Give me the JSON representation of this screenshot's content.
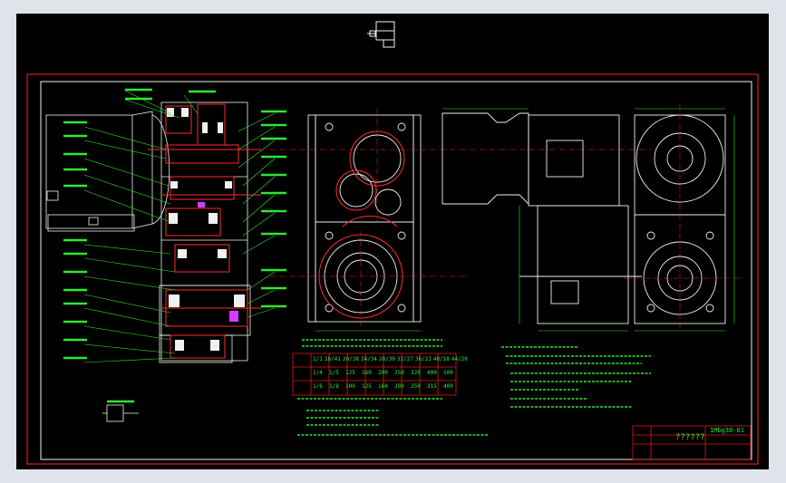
{
  "app": {
    "background": "#000000",
    "frame_color": "#e11a1a",
    "line_white": "#f0f0f0",
    "line_green": "#2ee82e",
    "line_red": "#ff2a2a",
    "line_cyan": "#35d6ff",
    "line_magenta": "#d63cff"
  },
  "title_block": {
    "title": "??????",
    "drawing_no": "1Mbg38-01"
  },
  "tables": {
    "ratio_table": {
      "headers": [
        "1/1",
        "16/41",
        "20/38",
        "24/34",
        "28/30",
        "32/27",
        "36/23",
        "40/18",
        "44/20"
      ],
      "row1": [
        "1/4",
        "1/5",
        "125",
        "160",
        "200",
        "250",
        "320",
        "400",
        "500"
      ],
      "row2": [
        "1/6",
        "1/8",
        "100",
        "125",
        "160",
        "200",
        "250",
        "315",
        "400"
      ]
    }
  }
}
